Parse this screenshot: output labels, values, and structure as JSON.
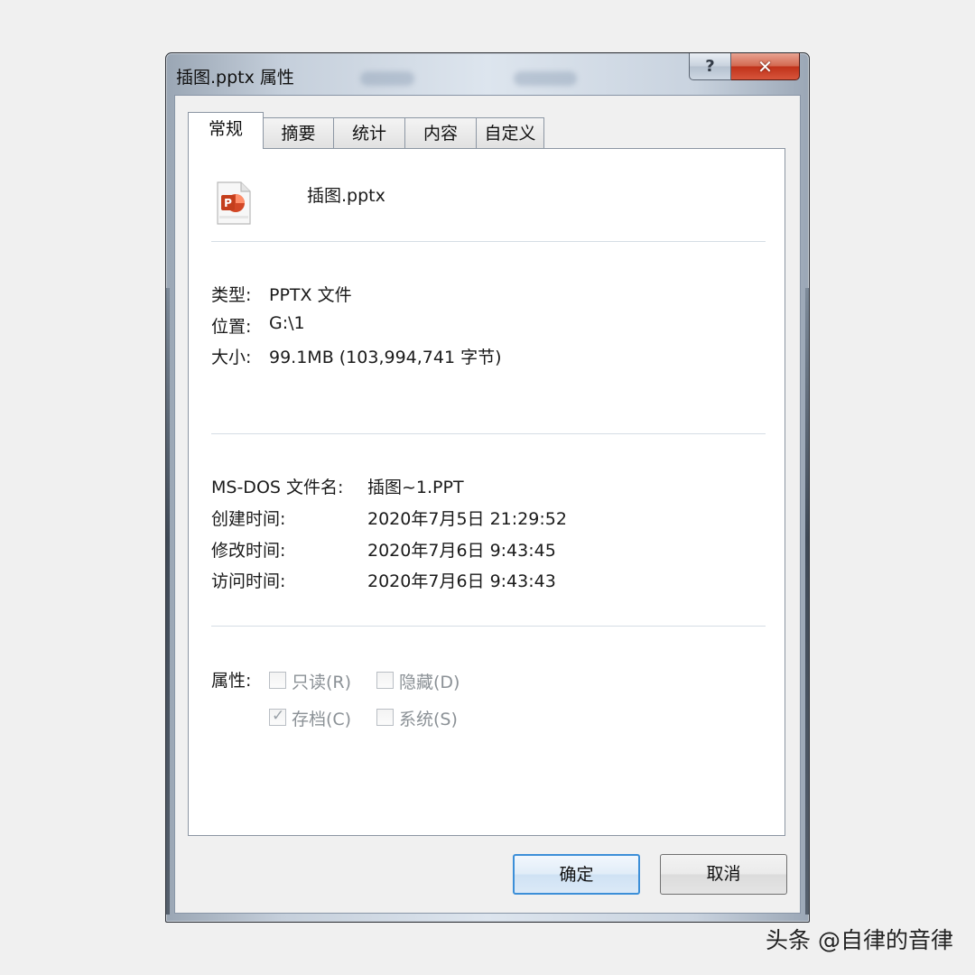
{
  "window": {
    "title": "插图.pptx 属性",
    "help_symbol": "?",
    "close_symbol": "✕"
  },
  "tabs": [
    {
      "label": "常规",
      "active": true
    },
    {
      "label": "摘要",
      "active": false
    },
    {
      "label": "统计",
      "active": false
    },
    {
      "label": "内容",
      "active": false
    },
    {
      "label": "自定义",
      "active": false
    }
  ],
  "general": {
    "file_icon": "powerpoint-file-icon",
    "file_name": "插图.pptx",
    "type_label": "类型:",
    "type_value": "PPTX 文件",
    "location_label": "位置:",
    "location_value": "G:\\1",
    "size_label": "大小:",
    "size_value": "99.1MB (103,994,741 字节)",
    "msdos_label": "MS-DOS 文件名:",
    "msdos_value": "插图~1.PPT",
    "created_label": "创建时间:",
    "created_value": "2020年7月5日 21:29:52",
    "modified_label": "修改时间:",
    "modified_value": "2020年7月6日 9:43:45",
    "accessed_label": "访问时间:",
    "accessed_value": "2020年7月6日 9:43:43",
    "attributes_label": "属性:",
    "attributes": [
      {
        "label": "只读(R)",
        "checked": false
      },
      {
        "label": "隐藏(D)",
        "checked": false
      },
      {
        "label": "存档(C)",
        "checked": true
      },
      {
        "label": "系统(S)",
        "checked": false
      }
    ]
  },
  "buttons": {
    "ok": "确定",
    "cancel": "取消"
  },
  "colors": {
    "accent_blue": "#3c8fd8",
    "close_red": "#c0321a",
    "ppt_orange": "#d24726"
  },
  "watermark": "头条 @自律的音律"
}
